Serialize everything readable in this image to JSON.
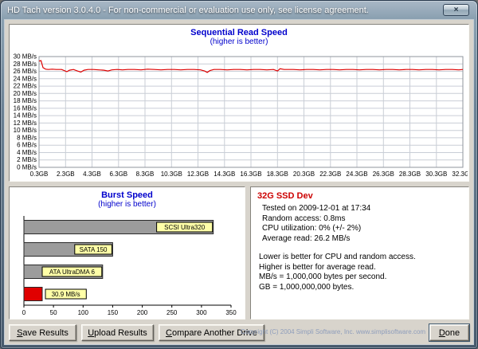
{
  "window": {
    "title": "HD Tach version 3.0.4.0  - For non-commercial or evaluation use only, see license agreement.",
    "close_icon": "×"
  },
  "info": {
    "drive_name": "32G SSD Dev",
    "stats": [
      "Tested on 2009-12-01 at 17:34",
      "Random access: 0.8ms",
      "CPU utilization: 0% (+/- 2%)",
      "Average read: 26.2 MB/s"
    ],
    "notes": [
      "Lower is better for CPU and random access.",
      "Higher is better for average read.",
      "MB/s = 1,000,000 bytes per second.",
      "GB = 1,000,000,000 bytes."
    ]
  },
  "buttons": {
    "save": "Save Results",
    "upload": "Upload Results",
    "compare": "Compare Another Drive",
    "done": "Done"
  },
  "footer": {
    "copyright": "Copyright (C) 2004 Simpli Software, Inc. www.simplisoftware.com"
  },
  "colors": {
    "chart_title_blue": "#0000cc",
    "drive_name_red": "#cc0000",
    "read_line_red": "#dd0000",
    "bar_gray": "#9c9c9c",
    "bar_red": "#e00000",
    "label_box_yellow": "#ffffa8",
    "copyright_gray_blue": "#8e9dbb"
  },
  "chart_data": [
    {
      "type": "line",
      "title": "Sequential Read Speed",
      "subtitle": "(higher is better)",
      "xlim": [
        0.3,
        32.3
      ],
      "ylim": [
        0,
        30
      ],
      "x_ticks": [
        0.3,
        2.3,
        4.3,
        6.3,
        8.3,
        10.3,
        12.3,
        14.3,
        16.3,
        18.3,
        20.3,
        22.3,
        24.3,
        26.3,
        28.3,
        30.3,
        32.3
      ],
      "x_tick_labels": [
        "0.3GB",
        "2.3GB",
        "4.3GB",
        "6.3GB",
        "8.3GB",
        "10.3GB",
        "12.3GB",
        "14.3GB",
        "16.3GB",
        "18.3GB",
        "20.3GB",
        "22.3GB",
        "24.3GB",
        "26.3GB",
        "28.3GB",
        "30.3GB",
        "32.3GB"
      ],
      "y_ticks": [
        0,
        2,
        4,
        6,
        8,
        10,
        12,
        14,
        16,
        18,
        20,
        22,
        24,
        26,
        28,
        30
      ],
      "y_tick_labels": [
        "0 MB/s",
        "2 MB/s",
        "4 MB/s",
        "6 MB/s",
        "8 MB/s",
        "10 MB/s",
        "12 MB/s",
        "14 MB/s",
        "16 MB/s",
        "18 MB/s",
        "20 MB/s",
        "22 MB/s",
        "24 MB/s",
        "26 MB/s",
        "28 MB/s",
        "30 MB/s"
      ],
      "grid": true,
      "grid_color": "#c9ced6",
      "line_color": "#dd0000",
      "points": [
        [
          0.3,
          28.8
        ],
        [
          0.45,
          28.9
        ],
        [
          0.6,
          27.0
        ],
        [
          0.8,
          26.6
        ],
        [
          1.0,
          26.5
        ],
        [
          1.3,
          26.6
        ],
        [
          1.6,
          26.5
        ],
        [
          2.0,
          26.5
        ],
        [
          2.2,
          26.2
        ],
        [
          2.4,
          25.9
        ],
        [
          2.6,
          26.3
        ],
        [
          2.9,
          26.5
        ],
        [
          3.2,
          26.1
        ],
        [
          3.45,
          25.8
        ],
        [
          3.7,
          26.3
        ],
        [
          4.0,
          26.5
        ],
        [
          4.4,
          26.5
        ],
        [
          4.8,
          26.4
        ],
        [
          5.2,
          26.3
        ],
        [
          5.5,
          26.1
        ],
        [
          5.8,
          26.4
        ],
        [
          6.2,
          26.5
        ],
        [
          6.6,
          26.4
        ],
        [
          7.0,
          26.5
        ],
        [
          7.5,
          26.5
        ],
        [
          8.0,
          26.4
        ],
        [
          8.5,
          26.6
        ],
        [
          9.0,
          26.5
        ],
        [
          9.5,
          26.4
        ],
        [
          10.0,
          26.5
        ],
        [
          10.5,
          26.5
        ],
        [
          11.0,
          26.4
        ],
        [
          11.5,
          26.5
        ],
        [
          12.0,
          26.5
        ],
        [
          12.5,
          26.4
        ],
        [
          12.8,
          26.1
        ],
        [
          13.0,
          25.7
        ],
        [
          13.2,
          26.2
        ],
        [
          13.5,
          26.5
        ],
        [
          14.0,
          26.5
        ],
        [
          14.5,
          26.4
        ],
        [
          15.0,
          26.5
        ],
        [
          15.5,
          26.5
        ],
        [
          16.0,
          26.4
        ],
        [
          16.5,
          26.5
        ],
        [
          17.0,
          26.5
        ],
        [
          17.5,
          26.4
        ],
        [
          18.0,
          26.5
        ],
        [
          18.3,
          26.1
        ],
        [
          18.5,
          26.7
        ],
        [
          18.8,
          26.5
        ],
        [
          19.5,
          26.5
        ],
        [
          20.0,
          26.4
        ],
        [
          20.5,
          26.5
        ],
        [
          21.0,
          26.5
        ],
        [
          21.5,
          26.4
        ],
        [
          22.0,
          26.5
        ],
        [
          22.5,
          26.5
        ],
        [
          23.0,
          26.4
        ],
        [
          23.5,
          26.5
        ],
        [
          24.0,
          26.5
        ],
        [
          24.5,
          26.4
        ],
        [
          25.0,
          26.5
        ],
        [
          25.5,
          26.5
        ],
        [
          26.0,
          26.4
        ],
        [
          26.5,
          26.5
        ],
        [
          27.0,
          26.5
        ],
        [
          27.5,
          26.4
        ],
        [
          28.0,
          26.5
        ],
        [
          28.5,
          26.5
        ],
        [
          29.0,
          26.4
        ],
        [
          29.5,
          26.5
        ],
        [
          30.0,
          26.5
        ],
        [
          30.5,
          26.4
        ],
        [
          31.0,
          26.5
        ],
        [
          31.5,
          26.5
        ],
        [
          32.0,
          26.4
        ],
        [
          32.3,
          26.5
        ]
      ]
    },
    {
      "type": "bar",
      "title": "Burst Speed",
      "subtitle": "(higher is better)",
      "orientation": "horizontal",
      "xlim": [
        0,
        350
      ],
      "x_ticks": [
        0,
        50,
        100,
        150,
        200,
        250,
        300,
        350
      ],
      "x_tick_labels": [
        "0",
        "50",
        "100",
        "150",
        "200",
        "250",
        "300",
        "350"
      ],
      "label_box_color": "#ffffa8",
      "bars": [
        {
          "label": "SCSI Ultra320",
          "value": 320,
          "color": "#9c9c9c"
        },
        {
          "label": "SATA 150",
          "value": 150,
          "color": "#9c9c9c"
        },
        {
          "label": "ATA UltraDMA 6",
          "value": 133,
          "color": "#9c9c9c"
        },
        {
          "label": "30.9 MB/s",
          "value": 30.9,
          "color": "#e00000"
        }
      ]
    }
  ]
}
